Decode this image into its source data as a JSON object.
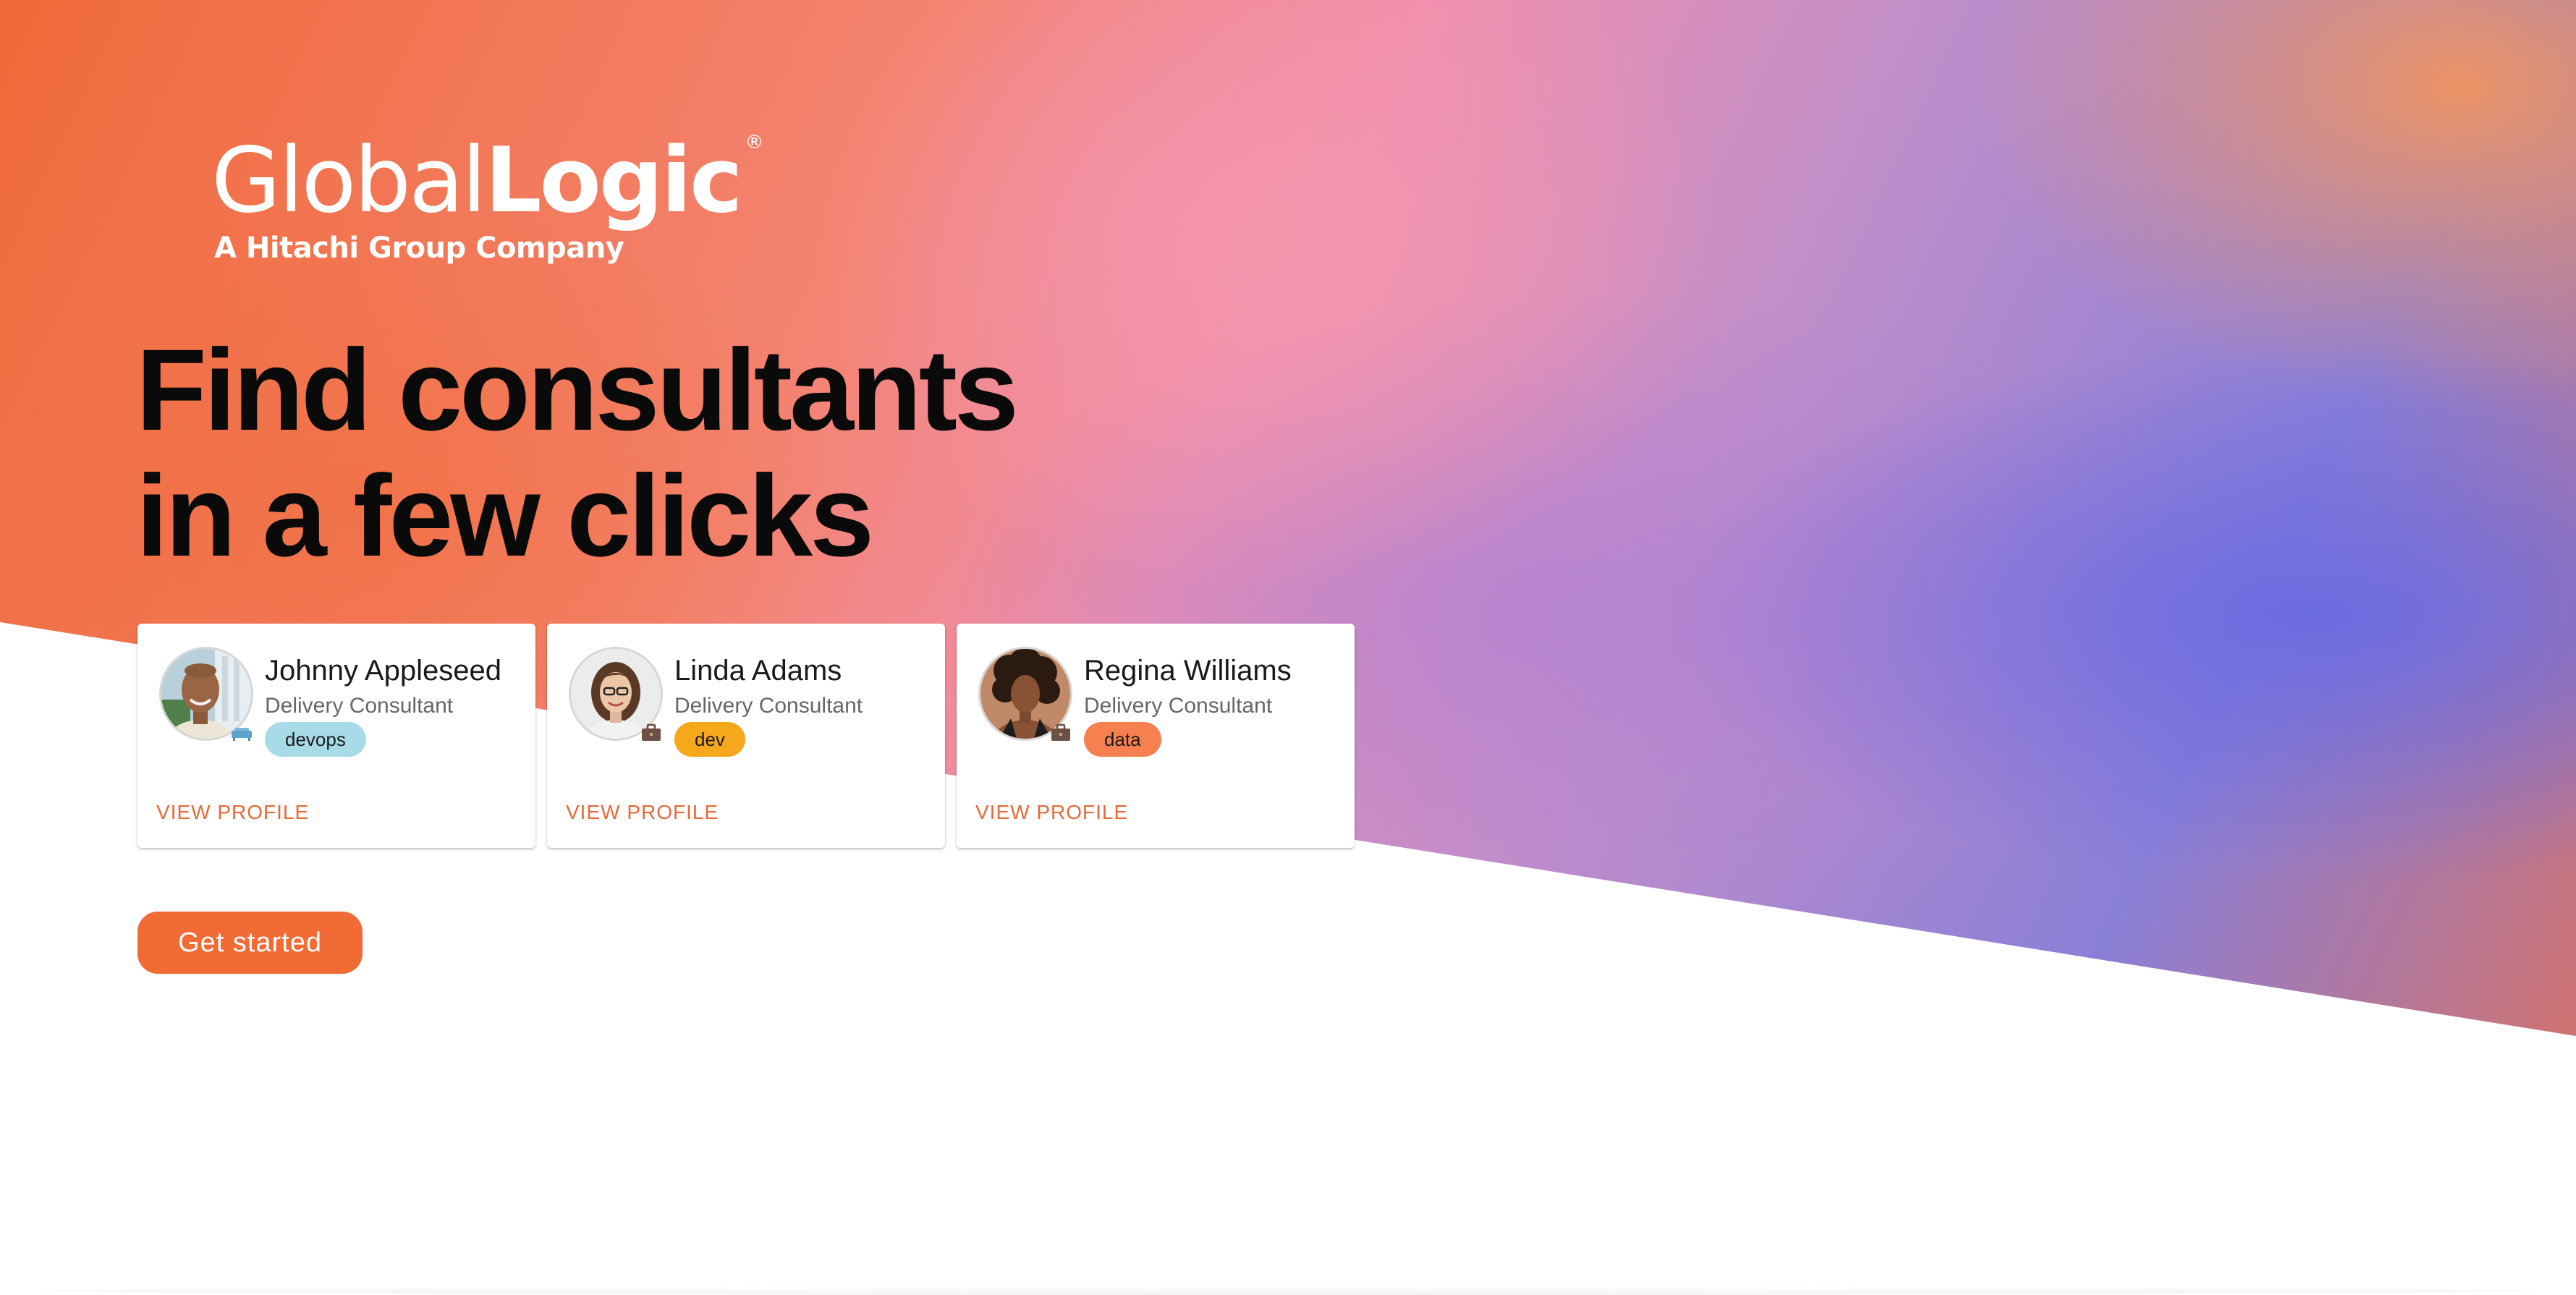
{
  "logo": {
    "word_light": "Global",
    "word_bold": "Logic",
    "registered": "®",
    "tagline": "A Hitachi Group Company"
  },
  "headline": {
    "line1": "Find consultants",
    "line2": "in a few clicks"
  },
  "consultants": [
    {
      "name": "Johnny Appleseed",
      "role": "Delivery Consultant",
      "tag": "devops",
      "tag_color": "#a8dbe8",
      "status_icon": "sofa-icon",
      "status_color": "#7fb8dc",
      "view_label": "VIEW PROFILE"
    },
    {
      "name": "Linda Adams",
      "role": "Delivery Consultant",
      "tag": "dev",
      "tag_color": "#f5a81c",
      "status_icon": "briefcase-icon",
      "status_color": "#6b5044",
      "view_label": "VIEW PROFILE"
    },
    {
      "name": "Regina Williams",
      "role": "Delivery Consultant",
      "tag": "data",
      "tag_color": "#f6804f",
      "status_icon": "briefcase-icon",
      "status_color": "#6b5044",
      "view_label": "VIEW PROFILE"
    }
  ],
  "cta": {
    "label": "Get started",
    "color": "#f26b35"
  },
  "colors": {
    "accent": "#e8683a",
    "headline": "#0a0a0a"
  }
}
